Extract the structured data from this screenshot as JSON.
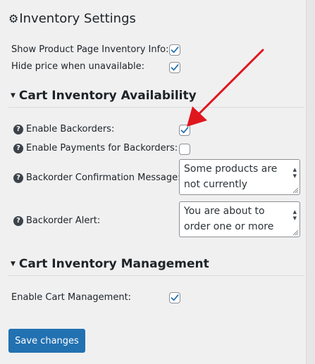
{
  "inventory_settings": {
    "title": "Inventory Settings",
    "icon": "gear-icon",
    "show_product_page_label": "Show Product Page Inventory Info:",
    "show_product_page_checked": true,
    "hide_price_label": "Hide price when unavailable:",
    "hide_price_checked": true
  },
  "cart_availability": {
    "title": "Cart Inventory Availability",
    "enable_backorders_label": "Enable Backorders:",
    "enable_backorders_checked": true,
    "enable_payments_label": "Enable Payments for Backorders:",
    "enable_payments_checked": false,
    "confirmation_message_label": "Backorder Confirmation Message:",
    "confirmation_message_value": "Some products are not currently",
    "alert_label": "Backorder Alert:",
    "alert_value": "You are about to order one or more"
  },
  "cart_management": {
    "title": "Cart Inventory Management",
    "enable_label": "Enable Cart Management:",
    "enable_checked": true
  },
  "actions": {
    "save_label": "Save changes"
  },
  "colors": {
    "primary": "#2271b1",
    "check": "#2271b1",
    "annotation_arrow": "#e0161d",
    "background": "#f0f0f1"
  }
}
